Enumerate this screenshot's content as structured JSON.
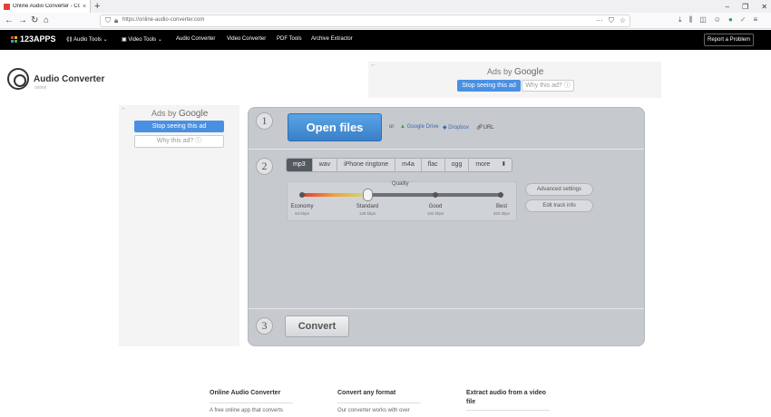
{
  "browser": {
    "tab_title": "Online Audio Converter - Con",
    "tab_close": "×",
    "new_tab": "+",
    "window_controls": [
      "–",
      "❐",
      "✕"
    ],
    "url": "https://online-audio-converter.com",
    "url_actions": [
      "···",
      "⛉",
      "☆"
    ],
    "toolbar_icons": [
      "⤓",
      "⫼",
      "◫",
      "☺",
      "●",
      "✓",
      "≡"
    ],
    "nav": {
      "back": "←",
      "forward": "→",
      "reload": "↻",
      "home": "⌂"
    }
  },
  "site_nav": {
    "brand": "123APPS",
    "items": [
      "Audio Tools",
      "Video Tools",
      "Audio Converter",
      "Video Converter",
      "PDF Tools",
      "Archive Extractor"
    ],
    "report": "Report a Problem",
    "logo_colors": [
      "#e84135",
      "#f4b400",
      "#4a90e2",
      "#43b05c"
    ]
  },
  "app": {
    "title": "Audio Converter",
    "subtitle": "online"
  },
  "ads": {
    "top": {
      "ads_by": "Ads by",
      "google": "Google",
      "stop": "Stop seeing this ad",
      "why": "Why this ad? ⓘ"
    },
    "left": {
      "ads_by": "Ads by",
      "google": "Google",
      "stop": "Stop seeing this ad",
      "why": "Why this ad? ⓘ"
    },
    "back_arrow": "←"
  },
  "converter": {
    "steps": [
      "1",
      "2",
      "3"
    ],
    "open_files": "Open files",
    "or": "or",
    "sources": [
      "Google Drive",
      "Dropbox",
      "URL"
    ],
    "formats": [
      "mp3",
      "wav",
      "iPhone ringtone",
      "m4a",
      "flac",
      "ogg",
      "more"
    ],
    "selected_format": "mp3",
    "more_arrow": "⬍",
    "quality_label": "Quality",
    "quality_level": "Standard",
    "quality_levels": [
      {
        "name": "Economy",
        "kbps": "64 kbps"
      },
      {
        "name": "Standard",
        "kbps": "128 kbps"
      },
      {
        "name": "Good",
        "kbps": "192 kbps"
      },
      {
        "name": "Best",
        "kbps": "320 kbps"
      }
    ],
    "advanced": "Advanced settings",
    "edit_track": "Edit track info",
    "convert": "Convert"
  },
  "footer": {
    "cols": [
      {
        "title": "Online Audio Converter",
        "text": "A free online app that converts"
      },
      {
        "title": "Convert any format",
        "text": "Our converter works with over"
      },
      {
        "title": "Extract audio from a video",
        "title2": "file",
        "text": ""
      }
    ]
  }
}
